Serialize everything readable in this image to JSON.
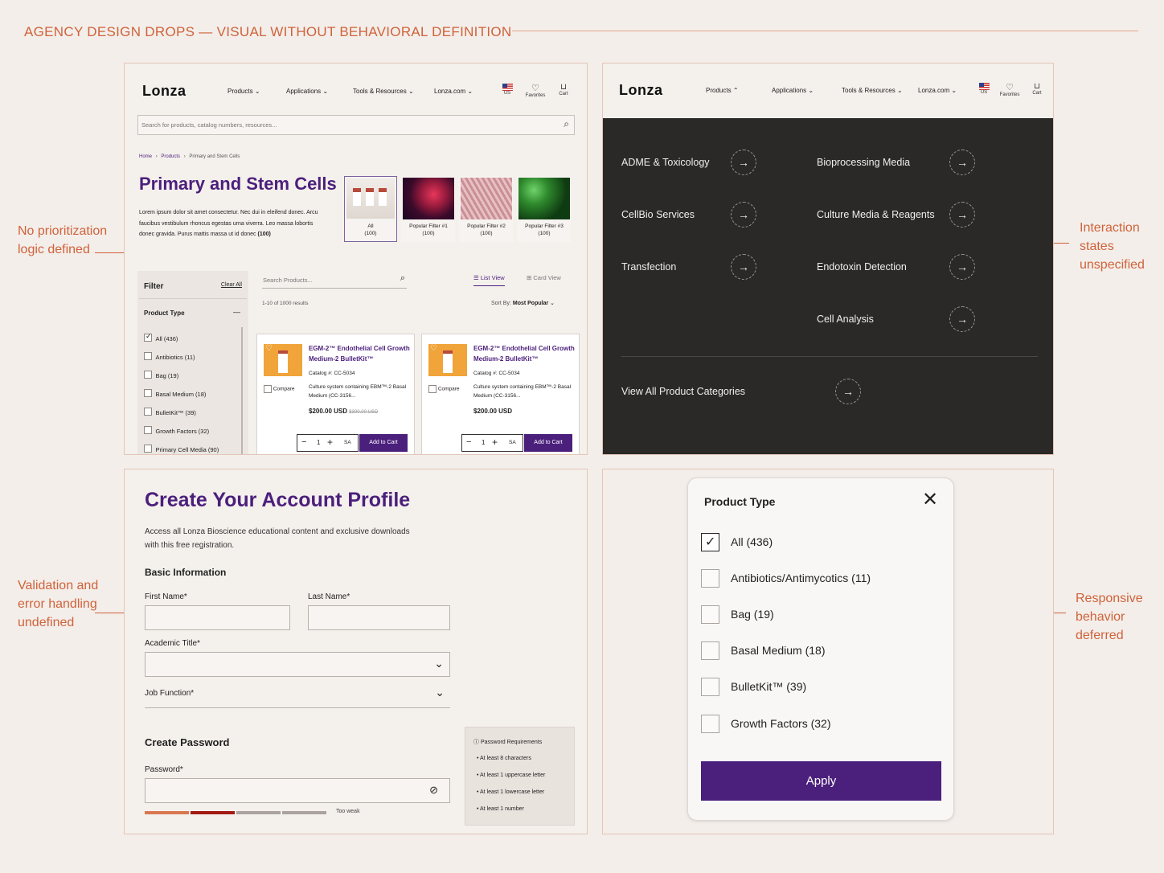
{
  "page": {
    "title": "AGENCY DESIGN DROPS — VISUAL WITHOUT BEHAVIORAL DEFINITION",
    "accent_color": "#d0623a",
    "brand_color": "#4b1f7c"
  },
  "annotations": {
    "a1": {
      "line1": "No prioritization",
      "line2": "logic defined"
    },
    "a2": {
      "line1": "Interaction",
      "line2": "states",
      "line3": "unspecified"
    },
    "a3": {
      "line1": "Validation and",
      "line2": "error handling",
      "line3": "undefined"
    },
    "a4": {
      "line1": "Responsive",
      "line2": "behavior",
      "line3": "deferred"
    }
  },
  "nav": {
    "logo": "Lonza",
    "items": [
      "Products",
      "Applications",
      "Tools & Resources",
      "Lonza.com"
    ],
    "icons": [
      {
        "name": "us-flag-icon",
        "label": "US"
      },
      {
        "name": "heart-icon",
        "label": "Favorites"
      },
      {
        "name": "cart-icon",
        "label": "Cart"
      }
    ]
  },
  "category_page": {
    "search_placeholder": "Search for products, catalog numbers, resources...",
    "breadcrumb": [
      "Home",
      "Products",
      "Primary and Stem Cells"
    ],
    "title": "Primary and Stem Cells",
    "description": "Lorem ipsum dolor sit amet consectetur. Nec dui in eleifend donec. Arcu faucibus vestibulum rhoncus egestas urna viverra. Leo massa lobortis donec gravida. Purus mattis massa ut id donec",
    "count": "(100)",
    "tiles": [
      {
        "label": "All",
        "count": "(100)"
      },
      {
        "label": "Popular Filter #1",
        "count": "(100)"
      },
      {
        "label": "Popular Filter #2",
        "count": "(100)"
      },
      {
        "label": "Popular Filter #3",
        "count": "(100)"
      }
    ],
    "filter": {
      "title": "Filter",
      "clear": "Clear All",
      "section": "Product Type",
      "collapse": "—",
      "items": [
        "All (436)",
        "Antibiotics (11)",
        "Bag (19)",
        "Basal Medium (18)",
        "BulletKit™ (39)",
        "Growth Factors (32)",
        "Primary Cell Media (90)"
      ]
    },
    "search_products_placeholder": "Search Products...",
    "list_view": "List View",
    "card_view": "Card View",
    "results": "1-10 of 1000 results",
    "sort_label": "Sort By:",
    "sort_value": "Most Popular",
    "products": [
      {
        "name": "EGM-2™ Endothelial Cell Growth Medium-2 BulletKit™",
        "catalog_label": "Catalog #:",
        "catalog": "CC-5034",
        "desc": "Culture system containing EBM™-2 Basal Medium (CC-3156...",
        "price": "$200.00 USD",
        "old_price": "$300.00 USD",
        "compare": "Compare",
        "qty": "1",
        "unit": "SA",
        "add": "Add to Cart"
      },
      {
        "name": "EGM-2™ Endothelial Cell Growth Medium-2 BulletKit™",
        "catalog_label": "Catalog #:",
        "catalog": "CC-5034",
        "desc": "Culture system containing EBM™-2 Basal Medium (CC-3156...",
        "price": "$200.00 USD",
        "old_price": "",
        "compare": "Compare",
        "qty": "1",
        "unit": "SA",
        "add": "Add to Cart"
      }
    ]
  },
  "mega_menu": {
    "left": [
      "ADME & Toxicology",
      "CellBio Services",
      "Transfection"
    ],
    "right": [
      "Bioprocessing Media",
      "Culture Media & Reagents",
      "Endotoxin Detection",
      "Cell Analysis"
    ],
    "view_all": "View All Product Categories"
  },
  "account_form": {
    "title": "Create Your Account Profile",
    "subtitle_line1": "Access all Lonza Bioscience educational content and exclusive downloads",
    "subtitle_line2": "with this free registration.",
    "basic_info": "Basic Information",
    "first_name": "First Name*",
    "last_name": "Last Name*",
    "academic_title": "Academic Title*",
    "job_function": "Job Function*",
    "create_password": "Create Password",
    "password": "Password*",
    "strength": "Too weak",
    "requirements_title": "Password Requirements",
    "requirements": [
      "At least 8 characters",
      "At least 1 uppercase letter",
      "At least 1 lowercase letter",
      "At least 1 number"
    ]
  },
  "filter_modal": {
    "title": "Product Type",
    "items": [
      {
        "label": "All (436)",
        "checked": true
      },
      {
        "label": "Antibiotics/Antimycotics (11)",
        "checked": false
      },
      {
        "label": "Bag (19)",
        "checked": false
      },
      {
        "label": "Basal Medium (18)",
        "checked": false
      },
      {
        "label": "BulletKit™ (39)",
        "checked": false
      },
      {
        "label": "Growth Factors (32)",
        "checked": false
      }
    ],
    "apply": "Apply"
  }
}
